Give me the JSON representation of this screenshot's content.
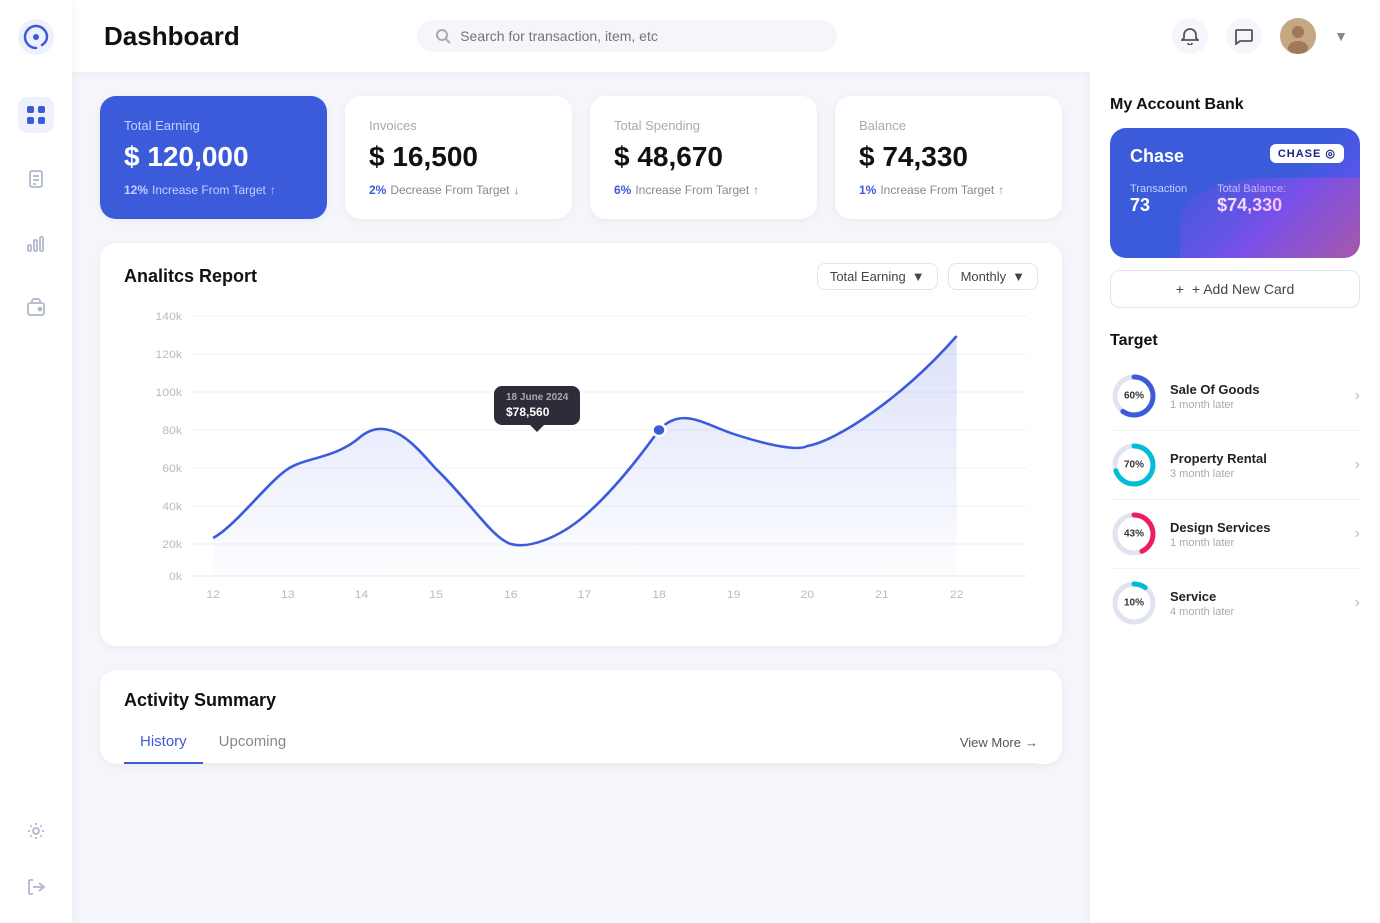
{
  "app": {
    "logo_alt": "App Logo",
    "title": "Dashboard"
  },
  "header": {
    "title": "Dashboard",
    "search_placeholder": "Search for transaction, item, etc"
  },
  "sidebar": {
    "items": [
      {
        "name": "dashboard",
        "label": "Dashboard",
        "active": true
      },
      {
        "name": "documents",
        "label": "Documents",
        "active": false
      },
      {
        "name": "analytics",
        "label": "Analytics",
        "active": false
      },
      {
        "name": "wallet",
        "label": "Wallet",
        "active": false
      }
    ],
    "bottom_items": [
      {
        "name": "settings",
        "label": "Settings"
      },
      {
        "name": "logout",
        "label": "Logout"
      }
    ]
  },
  "cards": [
    {
      "id": "total-earning",
      "label": "Total Earning",
      "value": "$ 120,000",
      "trend_pct": "12%",
      "trend_label": "Increase From Target",
      "trend_dir": "up",
      "blue": true
    },
    {
      "id": "invoices",
      "label": "Invoices",
      "value": "$ 16,500",
      "trend_pct": "2%",
      "trend_label": "Decrease From Target",
      "trend_dir": "down",
      "blue": false
    },
    {
      "id": "total-spending",
      "label": "Total Spending",
      "value": "$ 48,670",
      "trend_pct": "6%",
      "trend_label": "Increase From Target",
      "trend_dir": "up",
      "blue": false
    },
    {
      "id": "balance",
      "label": "Balance",
      "value": "$ 74,330",
      "trend_pct": "1%",
      "trend_label": "Increase From Target",
      "trend_dir": "up",
      "blue": false
    }
  ],
  "analytics": {
    "title": "Analitcs Report",
    "dropdown_earning": "Total Earning",
    "dropdown_period": "Monthly",
    "x_labels": [
      "12",
      "13",
      "14",
      "15",
      "16",
      "17",
      "18",
      "19",
      "20",
      "21",
      "22"
    ],
    "y_labels": [
      "0k",
      "20k",
      "40k",
      "60k",
      "80k",
      "100k",
      "120k",
      "140k"
    ],
    "tooltip_date": "18 June 2024",
    "tooltip_value": "$78,560"
  },
  "activity": {
    "title": "Activity Summary",
    "tabs": [
      {
        "id": "history",
        "label": "History",
        "active": true
      },
      {
        "id": "upcoming",
        "label": "Upcoming",
        "active": false
      }
    ],
    "view_more": "View More"
  },
  "bank": {
    "section_title": "My Account Bank",
    "card_name": "Chase",
    "card_logo": "CHASE ◎",
    "transaction_label": "Transaction",
    "transaction_value": "73",
    "balance_label": "Total Balance:",
    "balance_value": "$74,330",
    "add_card_label": "+ Add New Card"
  },
  "target": {
    "title": "Target",
    "items": [
      {
        "id": "sale-of-goods",
        "name": "Sale Of Goods",
        "sub": "1 month later",
        "pct": 60,
        "color": "#3b5bdb",
        "track_color": "#e0e4f0"
      },
      {
        "id": "property-rental",
        "name": "Property Rental",
        "sub": "3 month later",
        "pct": 70,
        "color": "#00bcd4",
        "track_color": "#e0e4f0"
      },
      {
        "id": "design-services",
        "name": "Design Services",
        "sub": "1 month later",
        "pct": 43,
        "color": "#e91e63",
        "track_color": "#e0e4f0"
      },
      {
        "id": "service",
        "name": "Service",
        "sub": "4 month later",
        "pct": 10,
        "color": "#00bcd4",
        "track_color": "#e0e4f0"
      }
    ]
  }
}
